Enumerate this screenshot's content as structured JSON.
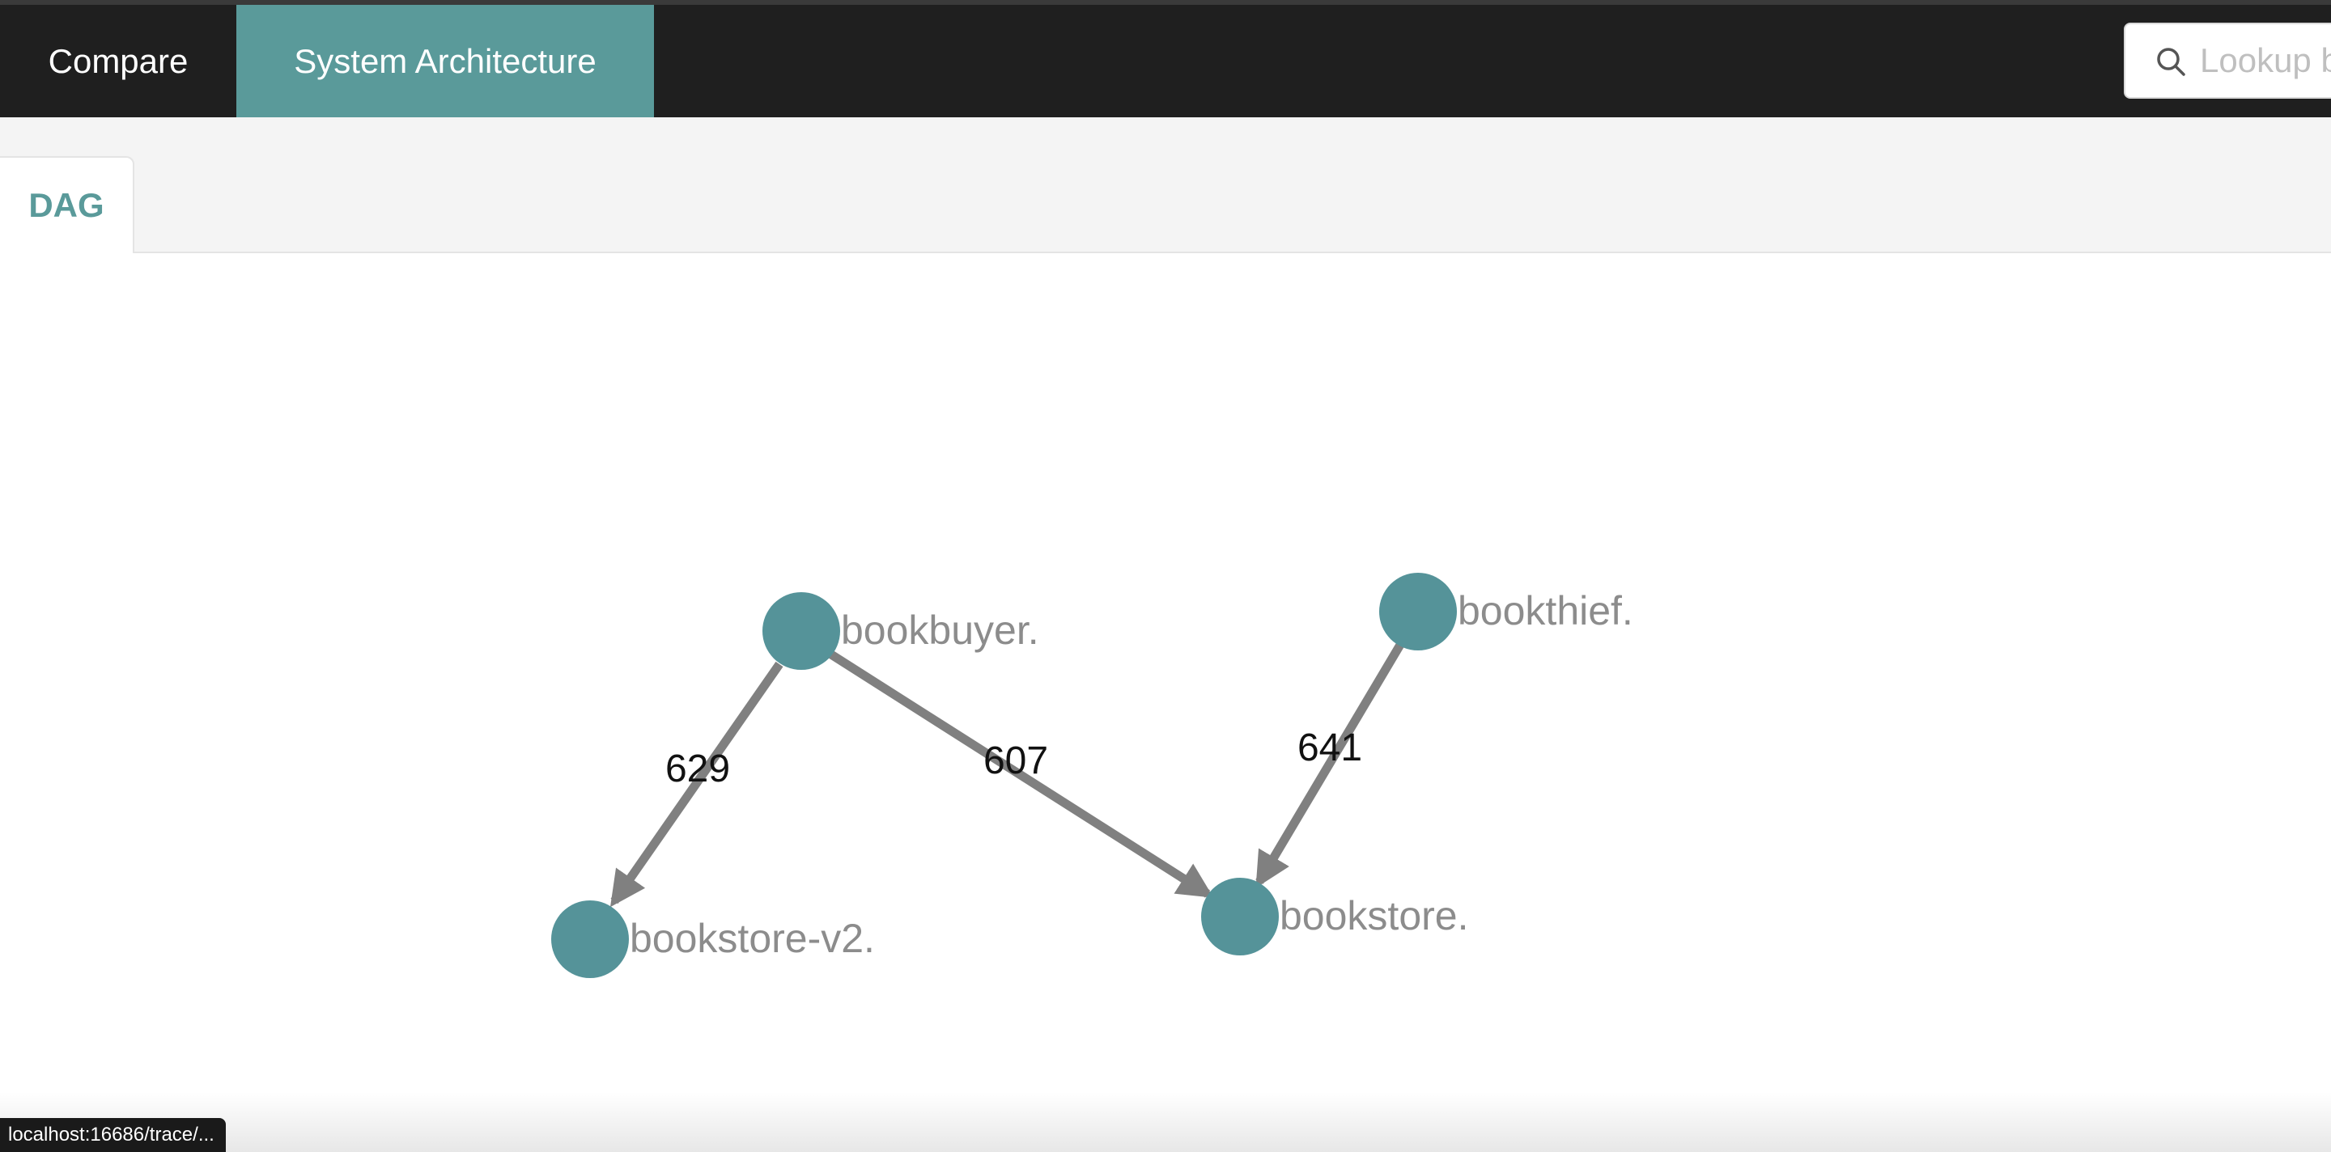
{
  "nav": {
    "items": [
      {
        "label": "Compare"
      },
      {
        "label": "System Architecture",
        "active": true
      }
    ],
    "search": {
      "placeholder": "Lookup by Trace ID..."
    }
  },
  "tabs": [
    {
      "label": "DAG",
      "active": true
    }
  ],
  "dag": {
    "nodes": [
      {
        "id": "bookbuyer",
        "label": "bookbuyer."
      },
      {
        "id": "bookthief",
        "label": "bookthief."
      },
      {
        "id": "bookstore-v2",
        "label": "bookstore-v2."
      },
      {
        "id": "bookstore",
        "label": "bookstore."
      }
    ],
    "edges": [
      {
        "from": "bookbuyer",
        "to": "bookstore-v2",
        "label": "629"
      },
      {
        "from": "bookbuyer",
        "to": "bookstore",
        "label": "607"
      },
      {
        "from": "bookthief",
        "to": "bookstore",
        "label": "641"
      }
    ]
  },
  "colors": {
    "accent": "#5a9a9a",
    "node_fill": "#559399",
    "edge": "#808080",
    "nav_bg": "#1f1f1f"
  },
  "status_bar": {
    "url": "localhost:16686/trace/..."
  }
}
